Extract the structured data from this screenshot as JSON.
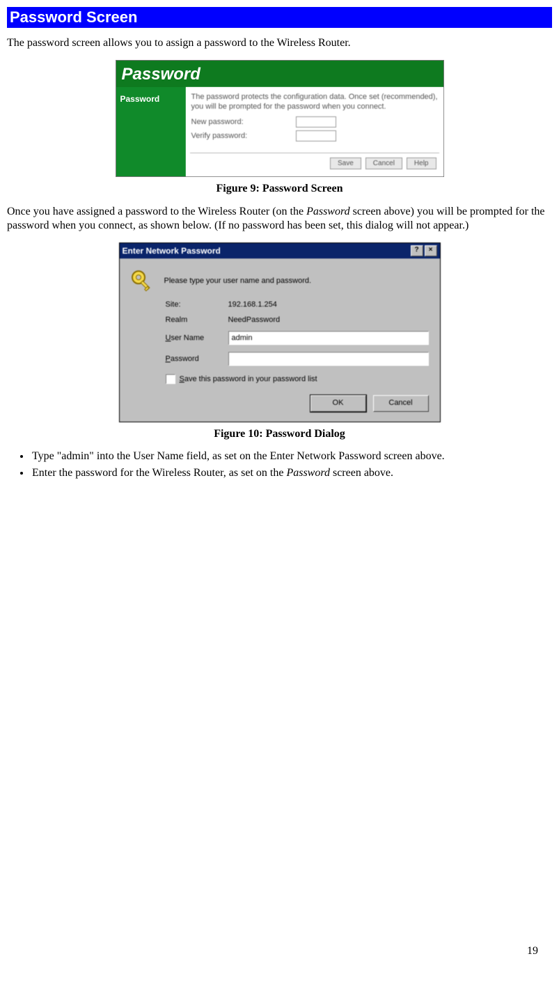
{
  "section_title": "Password Screen",
  "intro_text": "The password screen allows you to assign a password to the Wireless Router.",
  "figure1": {
    "title": "Password",
    "sidebar_label": "Password",
    "description": "The password protects the configuration data. Once set (recommended), you will be prompted for the password when you connect.",
    "row1_label": "New password:",
    "row2_label": "Verify password:",
    "btn_save": "Save",
    "btn_cancel": "Cancel",
    "btn_help": "Help",
    "caption": "Figure 9: Password Screen"
  },
  "mid_text_pre": "Once you have assigned a password to the Wireless Router (on the ",
  "mid_text_italic": "Password",
  "mid_text_post": " screen above) you will be prompted for the password when you connect, as shown below. (If no password has been set, this dialog will not appear.)",
  "figure2": {
    "titlebar": "Enter Network Password",
    "help_glyph": "?",
    "close_glyph": "×",
    "prompt": "Please type your user name and password.",
    "site_label": "Site:",
    "site_value": "192.168.1.254",
    "realm_label": "Realm",
    "realm_value": "NeedPassword",
    "username_label": "User Name",
    "username_value": "admin",
    "password_label": "Password",
    "password_value": "",
    "save_checkbox_label": "Save this password in your password list",
    "btn_ok": "OK",
    "btn_cancel": "Cancel",
    "caption": "Figure 10: Password Dialog"
  },
  "bullets": {
    "b1": "Type \"admin\" into the User Name field, as set on the Enter Network Password screen above.",
    "b2_pre": "Enter the password for the Wireless Router, as set on the ",
    "b2_italic": "Password",
    "b2_post": " screen above."
  },
  "page_number": "19"
}
